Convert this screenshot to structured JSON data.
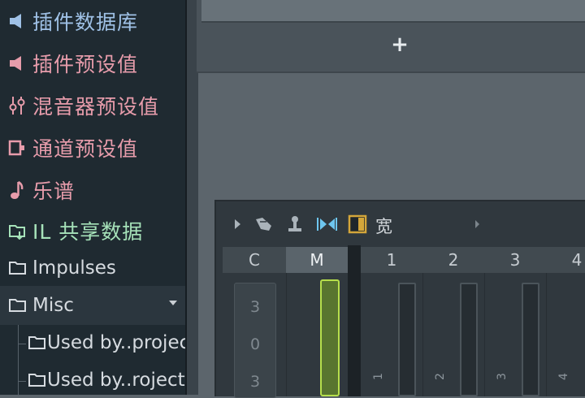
{
  "browser": {
    "items": [
      {
        "label": "插件数据库",
        "icon": "speaker-icon",
        "color": "#9fc1e6"
      },
      {
        "label": "插件预设值",
        "icon": "speaker-icon",
        "color": "#e79cab"
      },
      {
        "label": "混音器预设值",
        "icon": "mixer-sliders-icon",
        "color": "#e79cab"
      },
      {
        "label": "通道预设值",
        "icon": "channel-icon",
        "color": "#e79cab"
      },
      {
        "label": "乐谱",
        "icon": "music-note-icon",
        "color": "#e79cab"
      },
      {
        "label": "IL 共享数据",
        "icon": "folder-shared-icon",
        "color": "#a6e2b9"
      },
      {
        "label": "Impulses",
        "icon": "folder-icon",
        "color": "#d6dbe0"
      },
      {
        "label": "Misc",
        "icon": "folder-icon",
        "color": "#d6dbe0"
      },
      {
        "label": "Used by..projects",
        "icon": "folder-icon",
        "color": "#d6dbe0"
      },
      {
        "label": "Used by..rojects",
        "icon": "folder-icon",
        "color": "#d6dbe0"
      }
    ]
  },
  "top_panel": {
    "add_label": "+"
  },
  "mixer": {
    "title": "宽",
    "headers": [
      "C",
      "M",
      "1",
      "2",
      "3",
      "4"
    ],
    "current_strip_numbers": [
      "3",
      "0",
      "3"
    ],
    "track_numbers": [
      "1",
      "2",
      "3",
      "4"
    ],
    "accent_color": "#b6df4c"
  }
}
